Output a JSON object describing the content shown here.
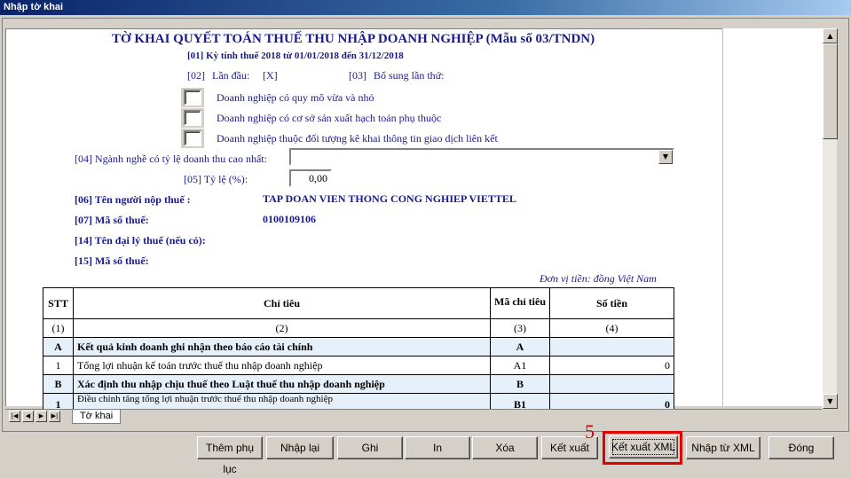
{
  "window": {
    "title": "Nhập tờ khai"
  },
  "form": {
    "title": "TỜ KHAI QUYẾT TOÁN THUẾ THU NHẬP DOANH NGHIỆP (Mẫu số 03/TNDN)",
    "period": "[01] Kỳ tính thuế 2018 từ 01/01/2018 đến 31/12/2018",
    "first_time_code": "[02]",
    "first_time_label": "Lần đầu:",
    "first_time_value": "[X]",
    "supplement_code": "[03]",
    "supplement_label": "Bổ sung lần thứ:",
    "checkboxes": [
      {
        "label": "Doanh nghiệp có quy mô vừa và nhỏ",
        "checked": false
      },
      {
        "label": "Doanh nghiệp có cơ sở sản xuất hạch toán phụ thuộc",
        "checked": false
      },
      {
        "label": "Doanh nghiệp thuộc đối tượng kê khai thông tin giao dịch liên kết",
        "checked": false
      }
    ],
    "industry_label": "[04] Ngành nghề có tỷ lệ doanh thu cao nhất:",
    "industry_value": "",
    "ratio_label": "[05] Tỷ lệ (%):",
    "ratio_value": "0,00",
    "taxpayer_label": "[06] Tên người nộp thuế :",
    "taxpayer_value": "TAP DOAN VIEN THONG CONG NGHIEP VIETTEL",
    "tax_code_label": "[07] Mã số thuế:",
    "tax_code_value": "0100109106",
    "agent_label": "[14] Tên đại lý thuế (nếu có):",
    "agent_tax_code_label": "[15] Mã số thuế:",
    "currency_note": "Đơn vị tiền: đồng Việt Nam"
  },
  "table": {
    "headers": [
      "STT",
      "Chỉ tiêu",
      "Mã chỉ tiêu",
      "Số tiền"
    ],
    "col_numbers": [
      "(1)",
      "(2)",
      "(3)",
      "(4)"
    ],
    "rows": [
      {
        "stt": "A",
        "label": "Kết quả kinh doanh ghi nhận theo báo cáo tài chính",
        "code": "A",
        "amount": "",
        "section": true
      },
      {
        "stt": "1",
        "label": "Tổng lợi nhuận kế toán trước thuế thu nhập doanh nghiệp",
        "code": "A1",
        "amount": "0",
        "section": false
      },
      {
        "stt": "B",
        "label": "Xác định thu nhập chịu thuế theo Luật thuế thu nhập doanh nghiệp",
        "code": "B",
        "amount": "",
        "section": true
      },
      {
        "stt": "1",
        "label": "Điều chỉnh tăng tổng lợi nhuận trước thuế thu nhập doanh nghiệp",
        "code": "B1",
        "amount": "0",
        "section": false
      }
    ]
  },
  "sheet_tab": "Tờ khai",
  "buttons": {
    "add_appendix": "Thêm phụ lục",
    "reenter": "Nhập lại",
    "save": "Ghi",
    "print": "In",
    "delete": "Xóa",
    "export": "Kết xuất",
    "export_xml": "Kết xuất XML",
    "import_xml": "Nhập từ XML",
    "close": "Đóng"
  },
  "annotation": {
    "step_number": "5",
    "color": "#e00000"
  },
  "colors": {
    "title_blue": "#1a1a8c",
    "section_row": "#e6f0fb",
    "window_face": "#d4d0c8"
  }
}
